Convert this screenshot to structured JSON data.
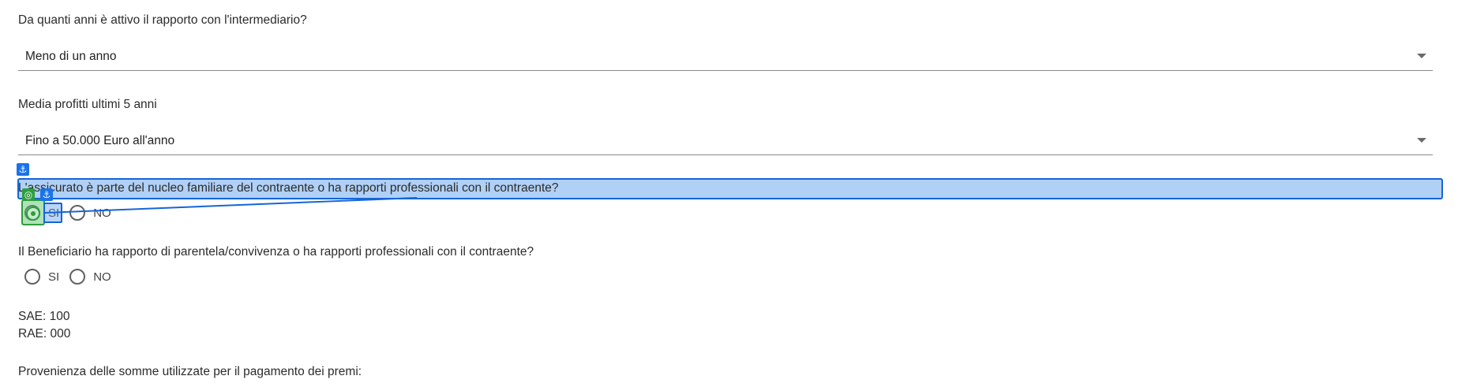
{
  "questions": {
    "q1_label": "Da quanti anni è attivo il rapporto con l'intermediario?",
    "q1_value": "Meno di un anno",
    "q2_label": "Media profitti ultimi 5 anni",
    "q2_value": "Fino a 50.000 Euro all'anno",
    "q3_label": "L'assicurato è parte del nucleo familiare del contraente o ha rapporti professionali con il contraente?",
    "q3_options": [
      "SI",
      "NO"
    ],
    "q4_label": "Il Beneficiario ha rapporto di parentela/convivenza o ha rapporti professionali con il contraente?",
    "q4_options": [
      "SI",
      "NO"
    ]
  },
  "info": {
    "sae": "SAE: 100",
    "rae": "RAE: 000"
  },
  "provenienza_label": "Provenienza delle somme utilizzate per il pagamento dei premi:",
  "overlay": {
    "anchor_icon": "anchor-icon",
    "target_icon": "target-icon",
    "accent": "#1565d8",
    "target_color": "#2e9e3e"
  }
}
